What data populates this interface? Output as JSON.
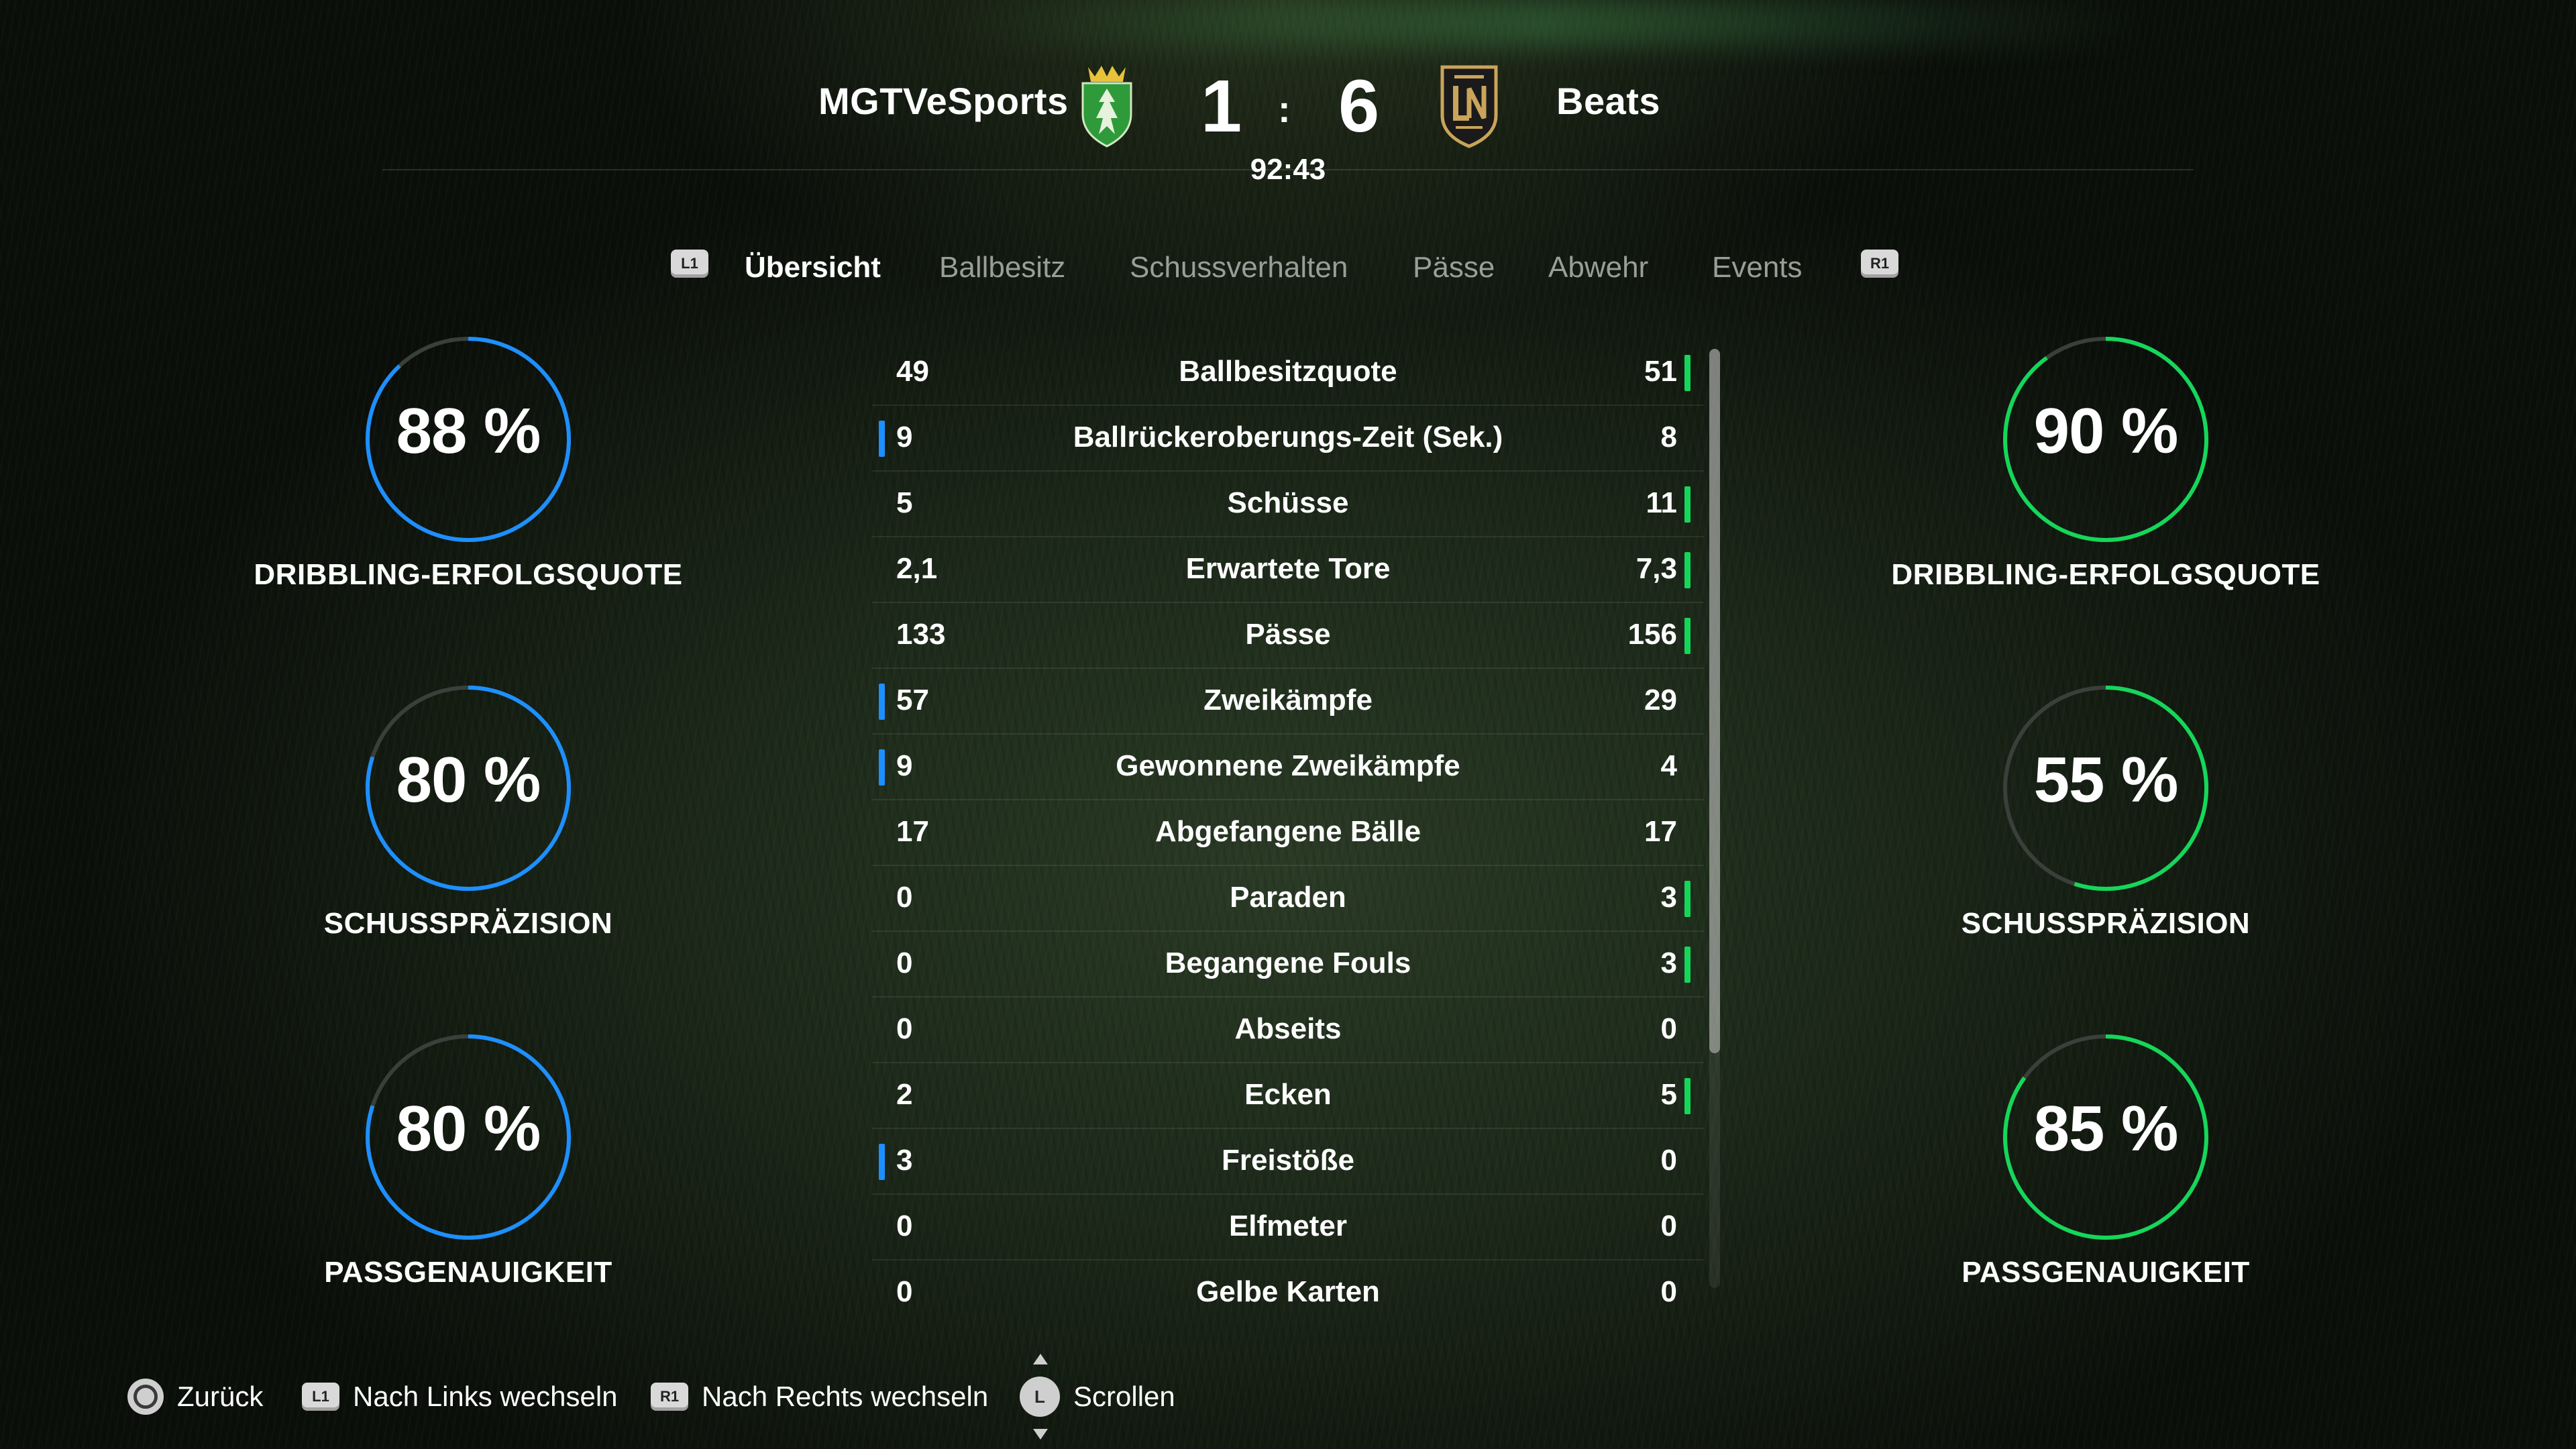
{
  "header": {
    "home_team": "MGTVeSports",
    "away_team": "Beats",
    "home_score": "1",
    "away_score": "6",
    "separator": ":",
    "clock": "92:43",
    "home_crest_icon": "green-shield-crown-crest-icon",
    "away_crest_icon": "lafc-crest-icon"
  },
  "tabs": {
    "left_button": "L1",
    "right_button": "R1",
    "items": [
      "Übersicht",
      "Ballbesitz",
      "Schussverhalten",
      "Pässe",
      "Abwehr",
      "Events"
    ],
    "active": "Übersicht"
  },
  "home_rings": [
    {
      "value": "88 %",
      "percent": 88,
      "label": "DRIBBLING-ERFOLGSQUOTE"
    },
    {
      "value": "80 %",
      "percent": 80,
      "label": "SCHUSSPRÄZISION"
    },
    {
      "value": "80 %",
      "percent": 80,
      "label": "PASSGENAUIGKEIT"
    }
  ],
  "away_rings": [
    {
      "value": "90 %",
      "percent": 90,
      "label": "DRIBBLING-ERFOLGSQUOTE"
    },
    {
      "value": "55 %",
      "percent": 55,
      "label": "SCHUSSPRÄZISION"
    },
    {
      "value": "85 %",
      "percent": 85,
      "label": "PASSGENAUIGKEIT"
    }
  ],
  "colors": {
    "home_accent": "#1e8fff",
    "away_accent": "#16d65a",
    "ring_track": "#3a3f3a"
  },
  "stats": [
    {
      "name": "Ballbesitzquote",
      "home": "49",
      "away": "51",
      "leader": "away"
    },
    {
      "name": "Ballrückeroberungs-Zeit (Sek.)",
      "home": "9",
      "away": "8",
      "leader": "home"
    },
    {
      "name": "Schüsse",
      "home": "5",
      "away": "11",
      "leader": "away"
    },
    {
      "name": "Erwartete Tore",
      "home": "2,1",
      "away": "7,3",
      "leader": "away"
    },
    {
      "name": "Pässe",
      "home": "133",
      "away": "156",
      "leader": "away"
    },
    {
      "name": "Zweikämpfe",
      "home": "57",
      "away": "29",
      "leader": "home"
    },
    {
      "name": "Gewonnene Zweikämpfe",
      "home": "9",
      "away": "4",
      "leader": "home"
    },
    {
      "name": "Abgefangene Bälle",
      "home": "17",
      "away": "17",
      "leader": "none"
    },
    {
      "name": "Paraden",
      "home": "0",
      "away": "3",
      "leader": "away"
    },
    {
      "name": "Begangene Fouls",
      "home": "0",
      "away": "3",
      "leader": "away"
    },
    {
      "name": "Abseits",
      "home": "0",
      "away": "0",
      "leader": "none"
    },
    {
      "name": "Ecken",
      "home": "2",
      "away": "5",
      "leader": "away"
    },
    {
      "name": "Freistöße",
      "home": "3",
      "away": "0",
      "leader": "home"
    },
    {
      "name": "Elfmeter",
      "home": "0",
      "away": "0",
      "leader": "none"
    },
    {
      "name": "Gelbe Karten",
      "home": "0",
      "away": "0",
      "leader": "none"
    }
  ],
  "footer": {
    "back_label": "Zurück",
    "back_icon": "circle-button-icon",
    "left_button": "L1",
    "left_label": "Nach Links wechseln",
    "right_button": "R1",
    "right_label": "Nach Rechts wechseln",
    "stick_button": "L",
    "scroll_label": "Scrollen"
  }
}
